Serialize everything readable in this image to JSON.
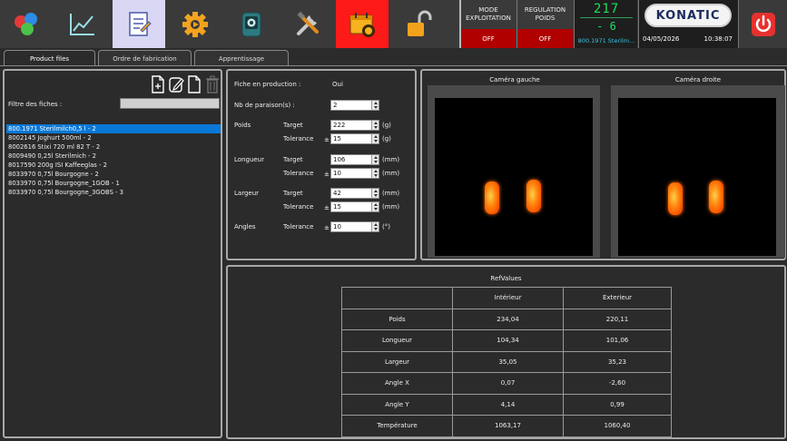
{
  "toolbar": {
    "icons": [
      "dots-icon",
      "chart-icon",
      "report-icon",
      "gear-icon",
      "camera-icon",
      "tools-icon",
      "alarm-calendar-icon",
      "unlock-icon"
    ],
    "active_index": 2
  },
  "mode_exploitation": {
    "label": "MODE\nEXPLOITATION",
    "value": "OFF"
  },
  "regulation_poids": {
    "label": "REGULATION\nPOIDS",
    "value": "OFF"
  },
  "counter": {
    "top": "217",
    "bottom": "- 6",
    "reference": "800.1971 Sterilm..."
  },
  "brand": {
    "logo": "KONATIC",
    "date": "04/05/2026",
    "time": "10:38:07"
  },
  "tabs": [
    "Product files",
    "Ordre de fabrication",
    "Apprentissage"
  ],
  "files": {
    "filter_label": "Filtre des fiches :",
    "filter_value": "",
    "items": [
      "800.1971 Sterilmilch0,5 l - 2",
      "8002145 Joghurt 500ml - 2",
      "8002616 Stixi 720 ml 82 T - 2",
      "8009490 0,25l Sterilmich - 2",
      "8017590 200g ISI Kaffeeglas - 2",
      "8033970 0,75l Bourgogne - 2",
      "8033970 0,75l Bourgogne_1GOB - 1",
      "8033970 0,75l Bourgogne_3GOBS - 3"
    ],
    "selected_index": 0
  },
  "params": {
    "production_label": "Fiche en production :",
    "production_value": "Oui",
    "paraison_label": "Nb de paraison(s) :",
    "paraison_value": "2",
    "target_label": "Target",
    "tolerance_label": "Tolerance",
    "pm": "±",
    "poids": {
      "label": "Poids",
      "target": "222",
      "tolerance": "15",
      "unit": "(g)"
    },
    "longueur": {
      "label": "Longueur",
      "target": "106",
      "tolerance": "10",
      "unit": "(mm)"
    },
    "largeur": {
      "label": "Largeur",
      "target": "42",
      "tolerance": "15",
      "unit": "(mm)"
    },
    "angles": {
      "label": "Angles",
      "tolerance": "10",
      "unit": "(°)"
    }
  },
  "cameras": {
    "left_title": "Caméra gauche",
    "right_title": "Caméra droite"
  },
  "refvalues": {
    "title": "RefValues",
    "headers": [
      "",
      "Intérieur",
      "Exterieur"
    ],
    "rows": [
      [
        "Poids",
        "234,04",
        "220,11"
      ],
      [
        "Longueur",
        "104,34",
        "101,06"
      ],
      [
        "Largeur",
        "35,05",
        "35,23"
      ],
      [
        "Angle X",
        "0,07",
        "-2,60"
      ],
      [
        "Angle Y",
        "4,14",
        "0,99"
      ],
      [
        "Température",
        "1063,17",
        "1060,40"
      ]
    ]
  }
}
